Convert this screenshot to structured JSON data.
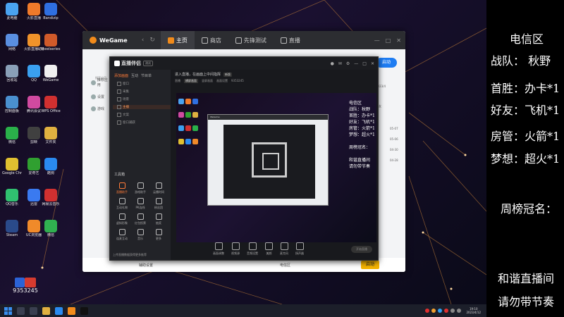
{
  "desktop": {
    "icons": [
      {
        "label": "此电脑",
        "color": "#4aa3f0"
      },
      {
        "label": "火影直播",
        "color": "#f07a2a"
      },
      {
        "label": "Bandizip",
        "color": "#2f6fe0"
      },
      {
        "label": "网络",
        "color": "#5a8fe0"
      },
      {
        "label": "火影直播助手",
        "color": "#f0932a"
      },
      {
        "label": "Steelseries GG",
        "color": "#d05a2a"
      },
      {
        "label": "回收站",
        "color": "#8aa0b8"
      },
      {
        "label": "QQ",
        "color": "#3aa0f0"
      },
      {
        "label": "WeGame",
        "color": "#f0f0f0"
      },
      {
        "label": "控制面板",
        "color": "#4a90d0"
      },
      {
        "label": "腾讯会议",
        "color": "#d04aa0"
      },
      {
        "label": "WPS Office",
        "color": "#d03030"
      },
      {
        "label": "微信",
        "color": "#2ab04a"
      },
      {
        "label": "剪映",
        "color": "#404040"
      },
      {
        "label": "文件夹",
        "color": "#e0b040"
      },
      {
        "label": "Google Chrome",
        "color": "#e0c030"
      },
      {
        "label": "爱奇艺",
        "color": "#30a030"
      },
      {
        "label": "酷狗",
        "color": "#2a8af0"
      },
      {
        "label": "QQ音乐",
        "color": "#30c070"
      },
      {
        "label": "迅雷",
        "color": "#3a7af0"
      },
      {
        "label": "网易云音乐",
        "color": "#d03030"
      },
      {
        "label": "Steam",
        "color": "#2a4a8a"
      },
      {
        "label": "UC浏览器",
        "color": "#f08a2a"
      },
      {
        "label": "微信",
        "color": "#30b050"
      }
    ],
    "counter": "9353245"
  },
  "wegame": {
    "logo": "WeGame",
    "tabs": [
      "主页",
      "商店",
      "先锋测试",
      "直播"
    ],
    "left_items": [
      "推荐应用",
      "设置",
      "游戏"
    ],
    "search_placeholder": "搜索应用",
    "go_button": "启动",
    "right_items": [
      "2023/4",
      "好友",
      "05-07",
      "05-06",
      "04-30",
      "04-28"
    ],
    "bottom_text": "辅助设置",
    "bottom_mid": "电信区",
    "start_button": "启动"
  },
  "stream_app": {
    "title": "直播伴侣",
    "version": "测试",
    "tabs": [
      "添加画面",
      "互动",
      "节目单"
    ],
    "sources": [
      "窗口",
      "采集",
      "场景",
      "主播",
      "文案",
      "窗口捕获"
    ],
    "tools_title": "工具箱",
    "tools": [
      "直播助手",
      "游戏助手",
      "云播时间",
      "互动礼物",
      "PK连线",
      "粉丝团",
      "虚拟形象",
      "红包投票",
      "抽奖",
      "连麦互动",
      "音乐",
      "更多"
    ],
    "footer": "上传直播数据获得更多推荐",
    "notice": "进入直播，在画面上中间指挥",
    "notice_tag": "新版",
    "subtabs": [
      "直播",
      "横屏画面",
      "竖屏画面",
      "画面设置",
      "9353245"
    ],
    "actions": [
      "画面调整",
      "视频源",
      "音频设置",
      "美颜",
      "麦克风",
      "扬声器"
    ],
    "golive": "开始直播",
    "preview_text": [
      "电信区",
      "战队：秋野",
      "首胜：办卡*1",
      "好友：飞机*1",
      "房管：火箭*1",
      "梦想：超火*1",
      "",
      "周榜冠名：",
      "",
      "和谐直播间",
      "请勿带节奏"
    ]
  },
  "overlay": {
    "lines": [
      "电信区",
      "战队：   秋野",
      "首胜：办卡*1",
      "好友：飞机*1",
      "房管：火箭*1",
      "梦想：超火*1",
      "周榜冠名：",
      "和谐直播间",
      "请勿带节奏"
    ]
  },
  "taskbar": {
    "icons": [
      "search-icon",
      "taskview-icon",
      "explorer-icon",
      "edge-icon",
      "wegame-icon",
      "stream-icon"
    ],
    "clock_time": "19:10",
    "clock_date": "2023/4/12"
  }
}
